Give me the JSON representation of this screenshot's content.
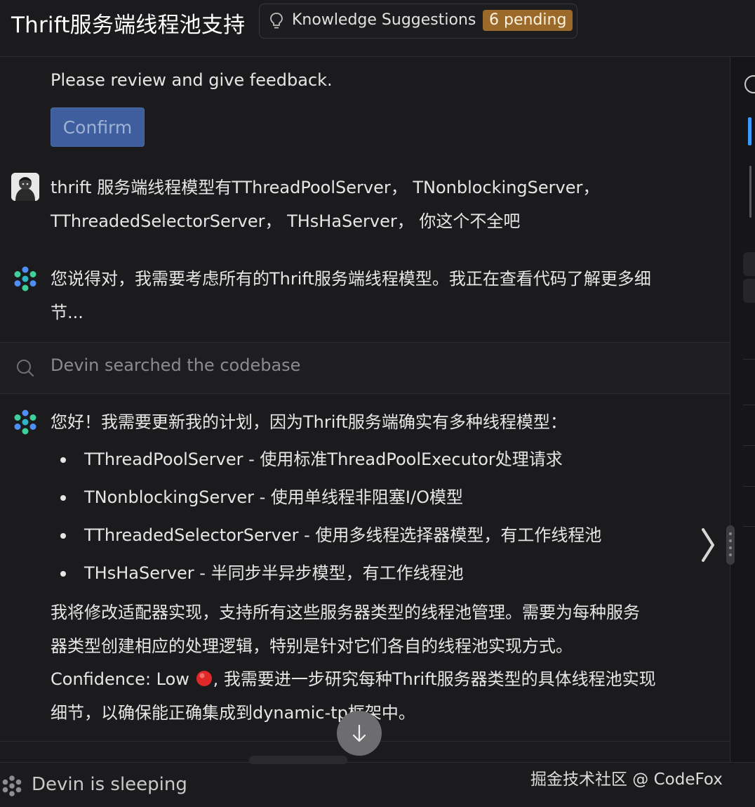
{
  "header": {
    "title": "Thrift服务端线程池支持",
    "knowledge_label": "Knowledge Suggestions",
    "pending_badge": "6 pending"
  },
  "chat": {
    "review_prompt": "Please review and give feedback.",
    "confirm_label": "Confirm",
    "user_message": {
      "line1": "thrift 服务端线程模型有TThreadPoolServer， TNonblockingServer，",
      "line2": "TThreadedSelectorServer， THsHaServer， 你这个不全吧"
    },
    "devin_reply1": {
      "line1": "您说得对，我需要考虑所有的Thrift服务端线程模型。我正在查看代码了解更多细",
      "line2": "节..."
    },
    "search_status": "Devin searched the codebase",
    "devin_reply2": {
      "intro": "您好！我需要更新我的计划，因为Thrift服务端确实有多种线程模型：",
      "bullets": [
        "TThreadPoolServer - 使用标准ThreadPoolExecutor处理请求",
        "TNonblockingServer - 使用单线程非阻塞I/O模型",
        "TThreadedSelectorServer - 使用多线程选择器模型，有工作线程池",
        "THsHaServer - 半同步半异步模型，有工作线程池"
      ],
      "para_line1": "我将修改适配器实现，支持所有这些服务器类型的线程池管理。需要为每种服务",
      "para_line2": "器类型创建相应的处理逻辑，特别是针对它们各自的线程池实现方式。",
      "confidence_line1_prefix": "Confidence: Low",
      "confidence_line1_suffix": ", 我需要进一步研究每种Thrift服务器类型的具体线程池实现",
      "confidence_line2": "细节，以确保能正确集成到dynamic-tp框架中。"
    }
  },
  "footer": {
    "status": "Devin is sleeping",
    "watermark": "掘金技术社区 @ CodeFox"
  },
  "colors": {
    "background": "#1b1b1d",
    "confirm_button": "#3f5e9e",
    "badge": "#9b6a2b",
    "confidence_low": "#e02828",
    "accent_blue": "#3b9bff"
  },
  "icons": [
    "lightbulb-icon",
    "search-icon",
    "devin-logo-icon",
    "arrow-down-icon",
    "chevron-right-icon",
    "gear-icon",
    "low-confidence-dot-icon"
  ]
}
